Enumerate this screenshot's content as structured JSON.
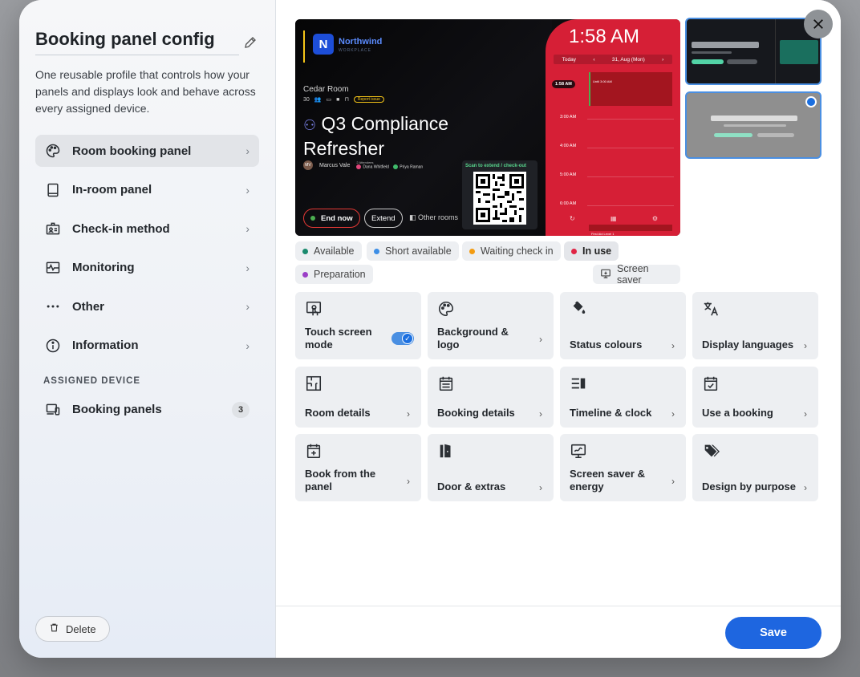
{
  "sidebar": {
    "title": "Booking panel config",
    "description": "One reusable profile that controls how your panels and displays look and behave across every assigned device.",
    "items": [
      {
        "label": "Room booking panel",
        "icon": "palette-icon"
      },
      {
        "label": "In-room panel",
        "icon": "tablet-icon"
      },
      {
        "label": "Check-in method",
        "icon": "badge-icon"
      },
      {
        "label": "Monitoring",
        "icon": "monitor-pulse-icon"
      },
      {
        "label": "Other",
        "icon": "ellipsis-icon"
      },
      {
        "label": "Information",
        "icon": "info-icon"
      }
    ],
    "assigned_heading": "ASSIGNED DEVICE",
    "assigned": {
      "label": "Booking panels",
      "count": "3"
    },
    "delete_label": "Delete"
  },
  "preview": {
    "brand": "Northwind",
    "brand_sub": "WORKPLACE",
    "logo_letter": "N",
    "room": "Cedar Room",
    "capacity": "30",
    "report": "Report issue",
    "meeting": "Q3 Compliance Refresher",
    "organizer": "Marcus Vale",
    "organizer_initials": "MV",
    "attendees_head": "2 Attendees",
    "attendee1": "Dana Whitfield",
    "attendee2": "Priya Raman",
    "end_now": "End now",
    "extend": "Extend",
    "other_rooms": "Other rooms",
    "qr_label": "Scan to extend / check-out",
    "clock": "1:58 AM",
    "today": "Today",
    "date": "31, Aug (Mon)",
    "now_tag": "1:58 AM",
    "t3": "3:00 AM",
    "t4": "4:00 AM",
    "t5": "5:00 AM",
    "t6": "6:00 AM",
    "block_label": "Until 3:00 AM",
    "block2_label": "First Aid Level 1"
  },
  "status_chips": [
    {
      "label": "Available",
      "color": "#1a8a6e"
    },
    {
      "label": "Short available",
      "color": "#3d8ee6"
    },
    {
      "label": "Waiting check in",
      "color": "#f39c12"
    },
    {
      "label": "In use",
      "color": "#e02444"
    },
    {
      "label": "Preparation",
      "color": "#9b3fc7"
    }
  ],
  "screen_saver_label": "Screen saver",
  "tiles": [
    {
      "label": "Touch screen mode",
      "icon": "touch-icon",
      "toggle": true
    },
    {
      "label": "Background & logo",
      "icon": "palette-icon"
    },
    {
      "label": "Status colours",
      "icon": "paint-bucket-icon"
    },
    {
      "label": "Display languages",
      "icon": "translate-icon"
    },
    {
      "label": "Room details",
      "icon": "floorplan-icon"
    },
    {
      "label": "Booking details",
      "icon": "calendar-list-icon"
    },
    {
      "label": "Timeline & clock",
      "icon": "timeline-icon"
    },
    {
      "label": "Use a booking",
      "icon": "calendar-check-icon"
    },
    {
      "label": "Book from the panel",
      "icon": "calendar-plus-icon"
    },
    {
      "label": "Door & extras",
      "icon": "door-icon"
    },
    {
      "label": "Screen saver & energy",
      "icon": "screensaver-icon"
    },
    {
      "label": "Design by purpose",
      "icon": "tags-icon"
    }
  ],
  "save_label": "Save",
  "colors": {
    "accent": "#1e66e0",
    "panel_red": "#d61f36"
  }
}
